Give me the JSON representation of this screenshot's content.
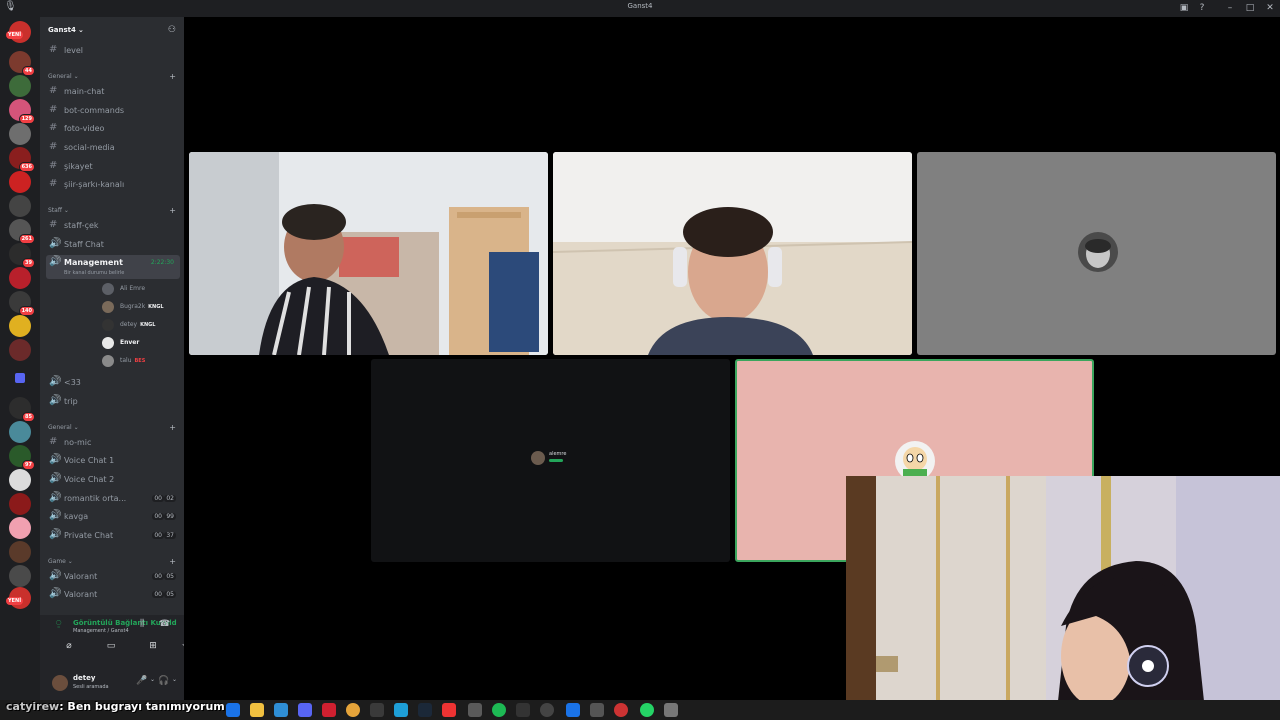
{
  "window": {
    "title": "Ganst4"
  },
  "guild": {
    "name": "Ganst4"
  },
  "rail_badges": [
    {
      "text": "YENİ",
      "type": "new"
    },
    {
      "text": "44"
    },
    {
      "text": "129"
    },
    {
      "text": "636"
    },
    {
      "text": "261"
    },
    {
      "text": "39"
    },
    {
      "text": "140"
    },
    {
      "text": "85"
    },
    {
      "text": "97"
    },
    {
      "text": "YENİ",
      "type": "new"
    }
  ],
  "channels": {
    "level": "level",
    "cat_general": "General",
    "main_chat": "main-chat",
    "bot_commands": "bot-commands",
    "foto_video": "foto-video",
    "social_media": "social-media",
    "sikayet": "şikayet",
    "siir": "şiir-şarkı-kanalı",
    "cat_staff": "Staff",
    "staff_cek": "staff-çek",
    "staff_chat": "Staff Chat",
    "management": "Management",
    "management_status": "Bir kanal durumu belirle",
    "management_timer": "2:22:30",
    "voice_users": [
      {
        "name": "Ali Emre",
        "tag": ""
      },
      {
        "name": "Bugra2k",
        "tag": "KNGL"
      },
      {
        "name": "detey",
        "tag": "KNGL"
      },
      {
        "name": "Enver",
        "tag": ""
      },
      {
        "name": "talu",
        "tag": "BES"
      }
    ],
    "lt33": "<33",
    "trip": "trip",
    "cat_general2": "General",
    "no_mic": "no-mic",
    "voice_chat_1": "Voice Chat 1",
    "voice_chat_2": "Voice Chat 2",
    "romantik": "romantik orta...",
    "romantik_cnt_a": "00",
    "romantik_cnt_b": "02",
    "kavga": "kavga",
    "kavga_cnt_a": "00",
    "kavga_cnt_b": "99",
    "private_chat": "Private Chat",
    "private_cnt_a": "00",
    "private_cnt_b": "37",
    "cat_game": "Game",
    "valorant_1": "Valorant",
    "valorant_1_cnt_a": "00",
    "valorant_1_cnt_b": "05",
    "valorant_2": "Valorant",
    "valorant_2_cnt_a": "00",
    "valorant_2_cnt_b": "05"
  },
  "voice_status": {
    "title": "Görüntülü Bağlantı Kuruld",
    "subtitle": "Management / Ganst4"
  },
  "user": {
    "name": "detey",
    "status": "Sesli aramada"
  },
  "stage": {
    "small_tile_name": "alemre"
  },
  "taskbar": {
    "chat_nick": "catyirew",
    "chat_message": ": Ben bugrayı tanımıyorum"
  },
  "colors": {
    "online": "#23a55a",
    "accent_red": "#f23f43",
    "pink_tile": "#e8b4ae",
    "speaking_border": "#3ba55d"
  }
}
